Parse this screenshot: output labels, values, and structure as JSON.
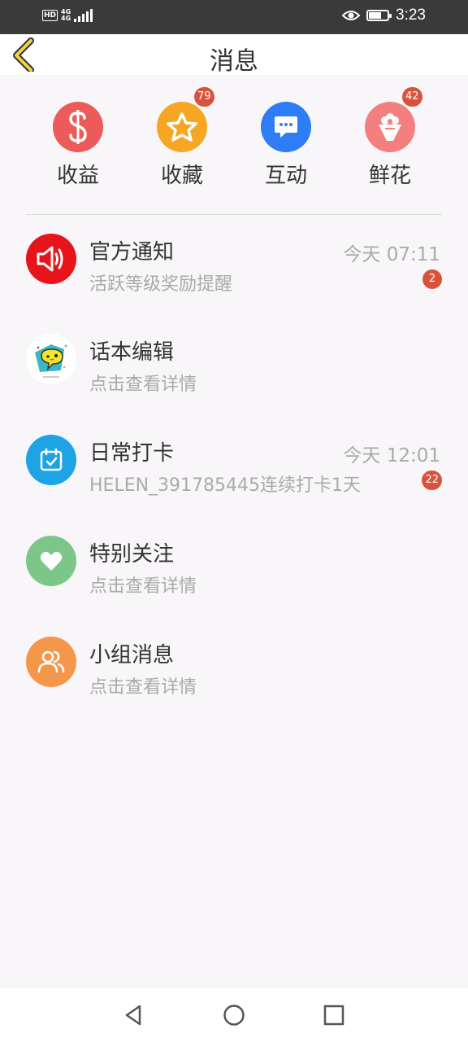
{
  "status_bar": {
    "hd": "HD",
    "network": "4G",
    "network_sub": "4G",
    "time": "3:23",
    "battery_level": 0.7,
    "icons": [
      "hd-icon",
      "signal-icon",
      "eye-icon",
      "battery-icon"
    ]
  },
  "header": {
    "title": "消息",
    "back_icon": "chevron-left-icon"
  },
  "quick_actions": [
    {
      "label": "收益",
      "icon": "dollar-icon",
      "color": "#ec5a5a"
    },
    {
      "label": "收藏",
      "icon": "star-icon",
      "color": "#f5a623",
      "badge": "79"
    },
    {
      "label": "互动",
      "icon": "chat-bubble-icon",
      "color": "#2f7df6"
    },
    {
      "label": "鲜花",
      "icon": "bouquet-icon",
      "color": "#f47f7f",
      "badge": "42"
    }
  ],
  "messages": [
    {
      "title": "官方通知",
      "subtitle": "活跃等级奖励提醒",
      "time": "今天 07:11",
      "badge": "2",
      "icon": "speaker-icon",
      "color": "#e8141c"
    },
    {
      "title": "话本编辑",
      "subtitle": "点击查看详情",
      "icon": "editor-avatar-icon",
      "color": "#ffffff"
    },
    {
      "title": "日常打卡",
      "subtitle": "HELEN_391785445连续打卡1天",
      "time": "今天 12:01",
      "badge": "22",
      "icon": "calendar-check-icon",
      "color": "#1ea3e5"
    },
    {
      "title": "特别关注",
      "subtitle": "点击查看详情",
      "icon": "heart-icon",
      "color": "#7cc68a"
    },
    {
      "title": "小组消息",
      "subtitle": "点击查看详情",
      "icon": "group-icon",
      "color": "#f5974a"
    }
  ],
  "nav": {
    "back": "triangle-back-icon",
    "home": "circle-home-icon",
    "recent": "square-recent-icon"
  }
}
